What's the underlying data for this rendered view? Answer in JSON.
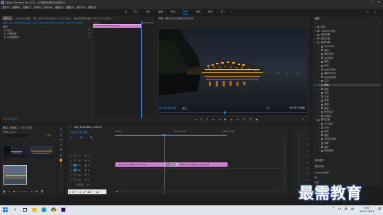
{
  "titlebar": {
    "title": "Adobe Premiere Pro 2020 - D:\\视频\\6\\新项目\\未命名 *"
  },
  "menu": [
    "文件(F)",
    "编辑(E)",
    "剪辑(C)",
    "序列(S)",
    "标记(M)",
    "图形(G)",
    "视图(V)",
    "窗口(W)",
    "帮助(H)"
  ],
  "workspaces": [
    "学习",
    "组件",
    "编辑",
    "颜色",
    "效果",
    "音频",
    "图形",
    "库",
    "»"
  ],
  "active_workspace": "效果",
  "source_panel": {
    "tabs": [
      "效果控件",
      "Lumetri 范围",
      "源：IMG_20210806_210232.jpg",
      "音频剪辑混合器：IMG_20210806_..."
    ],
    "subheader": "主要 * IMG_20210806_210232.jpg  ·  IMG_20210806_210232 * IMG_20210806_...",
    "rows": [
      "视频",
      "fx 运动",
      "fx 不透明度",
      "fx 时间重映射"
    ],
    "clip_label": "IMG_20210806_210232.jpg",
    "time_marks": [
      "00:00",
      "00:00:05:00"
    ]
  },
  "program_panel": {
    "tab": "节目：IMG_20210806_210232",
    "timecode": "00:00:04:09",
    "fit": "适合",
    "quality": "1/2",
    "duration": "00:00:10:00"
  },
  "project_panel": {
    "tabs": [
      "项目：未命名",
      "媒体浏览器"
    ],
    "project_file": "未命名.prproj",
    "item_count": "3 项"
  },
  "timeline": {
    "tab": "IMG_20210806_210232",
    "timecode": "00:00:04:09",
    "time_marks": [
      ":00:00",
      "00:00:05:00",
      "00:00:10:00"
    ],
    "video_tracks": [
      "V3",
      "V2",
      "V1"
    ],
    "audio_tracks": [
      "A1",
      "A2",
      "A3"
    ],
    "master": "主声道",
    "master_level": "0.0",
    "clip1": "IMG_20210806_210232.jpg",
    "clip2": "IMG_20210806_210437.jpg",
    "transition": "交叉"
  },
  "effects_panel": {
    "tab": "效果",
    "items": [
      {
        "label": "预设",
        "indent": 0
      },
      {
        "label": "Lumetri 预设",
        "indent": 0
      },
      {
        "label": "音频效果",
        "indent": 0
      },
      {
        "label": "音频过渡",
        "indent": 0
      },
      {
        "label": "视频效果",
        "indent": 0
      },
      {
        "label": "Obsolete",
        "indent": 1
      },
      {
        "label": "变换",
        "indent": 1
      },
      {
        "label": "图像控制",
        "indent": 1
      },
      {
        "label": "实用程序",
        "indent": 1
      },
      {
        "label": "扭曲",
        "indent": 1
      },
      {
        "label": "时间",
        "indent": 1
      },
      {
        "label": "杂色与颗粒",
        "indent": 1
      },
      {
        "label": "模糊与锐化",
        "indent": 1
      },
      {
        "label": "沉浸式视频",
        "indent": 1
      },
      {
        "label": "生成",
        "indent": 1
      },
      {
        "label": "视频",
        "indent": 1
      },
      {
        "label": "调整",
        "indent": 1
      },
      {
        "label": "过时",
        "indent": 1
      },
      {
        "label": "过渡",
        "indent": 1
      },
      {
        "label": "透视",
        "indent": 1
      },
      {
        "label": "通道",
        "indent": 1
      },
      {
        "label": "键控",
        "indent": 1
      },
      {
        "label": "颜色校正",
        "indent": 1
      },
      {
        "label": "风格化",
        "indent": 1
      },
      {
        "label": "视频过渡",
        "indent": 0
      },
      {
        "label": "3D 运动",
        "indent": 1
      },
      {
        "label": "内滑",
        "indent": 1
      },
      {
        "label": "划像",
        "indent": 1
      },
      {
        "label": "擦除",
        "indent": 1
      },
      {
        "label": "沉浸式视频",
        "indent": 1
      },
      {
        "label": "溶解",
        "indent": 1
      },
      {
        "label": "缩放",
        "indent": 1
      },
      {
        "label": "页面剥落",
        "indent": 1
      }
    ],
    "highlighted": "视频",
    "bottom_items": [
      "基本图形",
      "基本声音",
      "Lumetri 颜色",
      "库",
      "标记"
    ]
  },
  "watermark": "最需教育",
  "taskbar": {
    "time": "9:47",
    "date": "2021/10/15"
  }
}
